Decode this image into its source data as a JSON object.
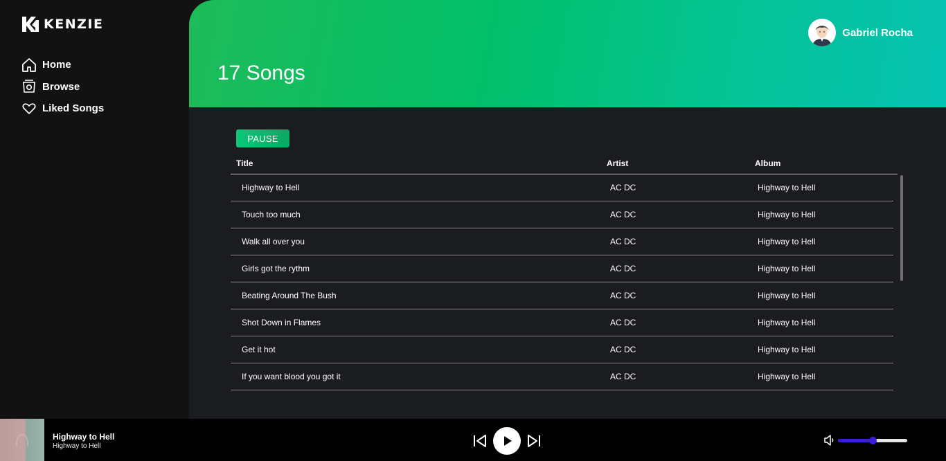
{
  "brand": {
    "name": "KENZIE"
  },
  "nav": [
    {
      "label": "Home",
      "icon": "home-icon"
    },
    {
      "label": "Browse",
      "icon": "browse-icon"
    },
    {
      "label": "Liked Songs",
      "icon": "heart-icon"
    }
  ],
  "header": {
    "title": "17 Songs"
  },
  "user": {
    "name": "Gabriel Rocha"
  },
  "actions": {
    "pause_label": "PAUSE"
  },
  "table": {
    "columns": [
      "Title",
      "Artist",
      "Album"
    ],
    "rows": [
      {
        "title": "Highway to Hell",
        "artist": "AC DC",
        "album": "Highway to Hell"
      },
      {
        "title": "Touch too much",
        "artist": "AC DC",
        "album": "Highway to Hell"
      },
      {
        "title": "Walk all over you",
        "artist": "AC DC",
        "album": "Highway to Hell"
      },
      {
        "title": "Girls got the rythm",
        "artist": "AC DC",
        "album": "Highway to Hell"
      },
      {
        "title": "Beating Around The Bush",
        "artist": "AC DC",
        "album": "Highway to Hell"
      },
      {
        "title": "Shot Down in Flames",
        "artist": "AC DC",
        "album": "Highway to Hell"
      },
      {
        "title": "Get it hot",
        "artist": "AC DC",
        "album": "Highway to Hell"
      },
      {
        "title": "If you want blood you got it",
        "artist": "AC DC",
        "album": "Highway to Hell"
      }
    ]
  },
  "player": {
    "track_title": "Highway to Hell",
    "track_album": "Highway to Hell",
    "volume_fraction": 0.5
  },
  "colors": {
    "accent": "#0bb46a",
    "volume": "#3a1fd6",
    "background": "#1b1c1f"
  }
}
